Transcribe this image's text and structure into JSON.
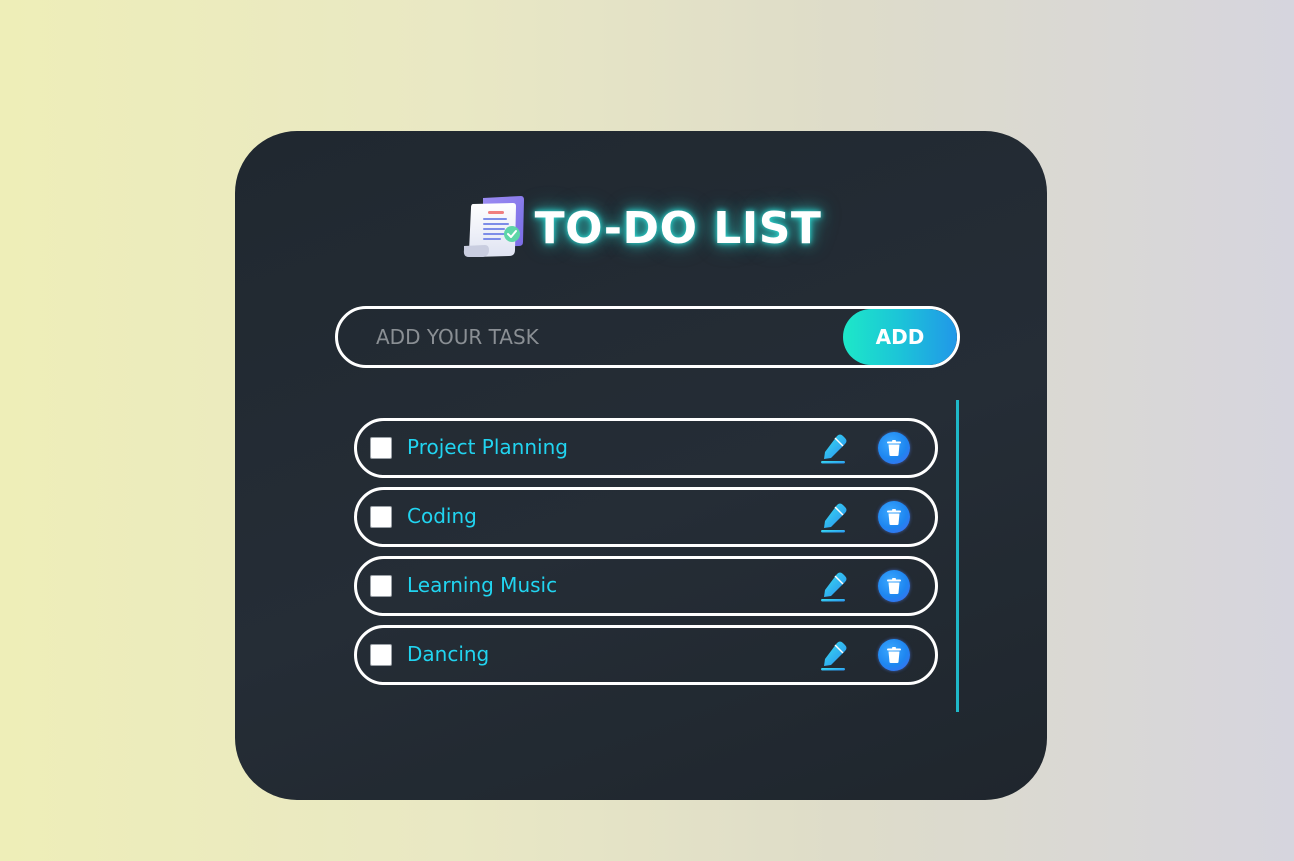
{
  "header": {
    "title": "TO-DO LIST",
    "logo_icon": "checklist-document-icon"
  },
  "input": {
    "placeholder": "ADD YOUR TASK",
    "value": "",
    "add_label": "ADD"
  },
  "tasks": [
    {
      "label": "Project Planning",
      "checked": false
    },
    {
      "label": "Coding",
      "checked": false
    },
    {
      "label": "Learning Music",
      "checked": false
    },
    {
      "label": "Dancing",
      "checked": false
    }
  ],
  "icons": {
    "edit": "pencil-icon",
    "delete": "trash-icon"
  },
  "colors": {
    "card_background": "#232a32",
    "task_text": "#21d4f0",
    "title_glow": "#2ee8e0",
    "add_gradient_start": "#1de8c8",
    "add_gradient_end": "#2197e8",
    "scrollbar": "#1fb8c8",
    "delete_button": "#1e86f0"
  }
}
